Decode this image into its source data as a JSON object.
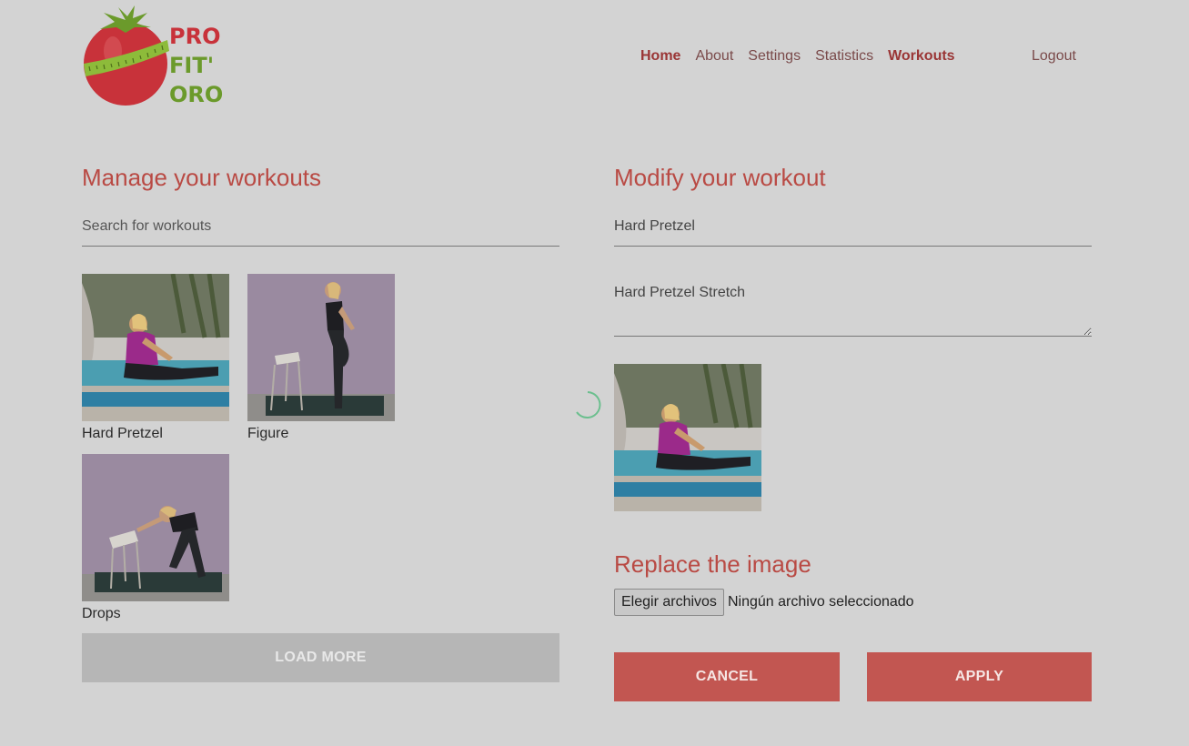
{
  "brand": {
    "logo_text": [
      "PRO",
      "FIT'",
      "ORO"
    ],
    "colors": {
      "tomato": "#c8323a",
      "leaf": "#6b9a2b",
      "tape": "#8dbb3a"
    }
  },
  "nav": {
    "items": [
      {
        "label": "Home",
        "active": true
      },
      {
        "label": "About",
        "active": false
      },
      {
        "label": "Settings",
        "active": false
      },
      {
        "label": "Statistics",
        "active": false
      },
      {
        "label": "Workouts",
        "active": true
      }
    ],
    "logout": "Logout"
  },
  "manage": {
    "title": "Manage your workouts",
    "search_placeholder": "Search for workouts",
    "workouts": [
      {
        "title": "Hard Pretzel",
        "image": "pool-stretch-photo"
      },
      {
        "title": "Figure",
        "image": "wall-stretch-photo"
      },
      {
        "title": "Drops",
        "image": "chair-lunge-photo"
      }
    ],
    "load_more": "LOAD MORE"
  },
  "modify": {
    "title": "Modify your workout",
    "name_value": "Hard Pretzel",
    "description_value": "Hard Pretzel Stretch",
    "replace_title": "Replace the image",
    "file_button": "Elegir archivos",
    "file_status": "Ningún archivo seleccionado",
    "cancel": "CANCEL",
    "apply": "APPLY"
  },
  "theme": {
    "accent": "#c25651",
    "heading": "#b94a44",
    "overlay_background": "#d3d3d3",
    "spinner": "#6bbf8e"
  }
}
